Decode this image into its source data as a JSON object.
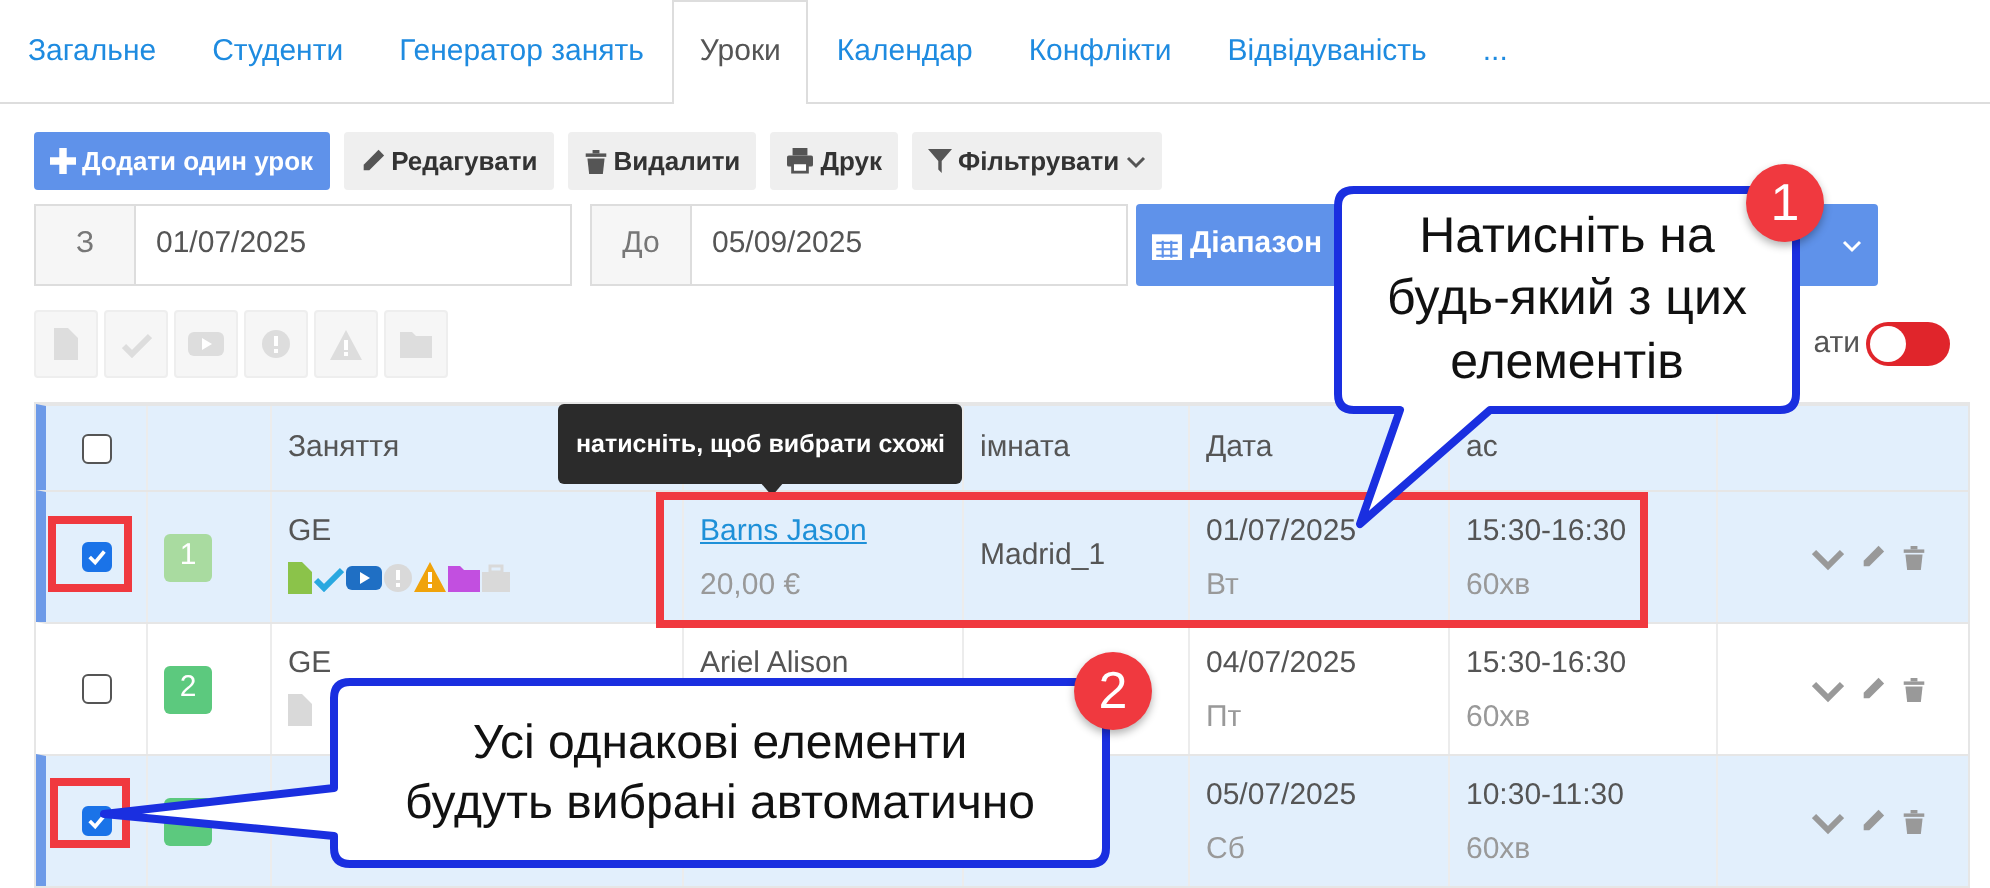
{
  "tabs": [
    {
      "label": "Загальне",
      "selected": false
    },
    {
      "label": "Студенти",
      "selected": false
    },
    {
      "label": "Генератор занять",
      "selected": false
    },
    {
      "label": "Уроки",
      "selected": true
    },
    {
      "label": "Календар",
      "selected": false
    },
    {
      "label": "Конфлікти",
      "selected": false
    },
    {
      "label": "Відвідуваність",
      "selected": false
    },
    {
      "label": "...",
      "selected": false
    }
  ],
  "toolbar": [
    {
      "kind": "add",
      "label": "Додати один урок",
      "primary": true
    },
    {
      "kind": "edit",
      "label": "Редагувати",
      "primary": false
    },
    {
      "kind": "delete",
      "label": "Видалити",
      "primary": false
    },
    {
      "kind": "print",
      "label": "Друк",
      "primary": false
    },
    {
      "kind": "filter",
      "label": "Фільтрувати",
      "primary": false
    }
  ],
  "date_range": {
    "from_label": "З",
    "from_value": "01/07/2025",
    "to_label": "До",
    "to_value": "05/09/2025",
    "range_button": "Діапазон"
  },
  "bulk_buttons": [
    {
      "kind": "document",
      "disabled": true
    },
    {
      "kind": "check",
      "disabled": true
    },
    {
      "kind": "video",
      "disabled": true
    },
    {
      "kind": "info",
      "disabled": true
    },
    {
      "kind": "warning",
      "disabled": true
    },
    {
      "kind": "folder",
      "disabled": true
    }
  ],
  "toggle": {
    "label": "ати",
    "on": false
  },
  "table": {
    "header": {
      "checked": false,
      "lesson": "Заняття",
      "room": "імната",
      "date": "Дата",
      "time": "ас"
    },
    "rows": [
      {
        "checked": true,
        "number": "1",
        "faded": true,
        "lesson": "GE",
        "status_icons": [
          {
            "kind": "document",
            "active": true
          },
          {
            "kind": "check",
            "active": true
          },
          {
            "kind": "video",
            "active": true
          },
          {
            "kind": "info",
            "active": false
          },
          {
            "kind": "warning",
            "active": true
          },
          {
            "kind": "folder",
            "active": true
          },
          {
            "kind": "briefcase",
            "active": false
          }
        ],
        "teacher": "Barns Jason",
        "link": true,
        "price": "20,00 €",
        "room": "Madrid_1",
        "date": "01/07/2025",
        "weekday": "Вт",
        "time": "15:30-16:30",
        "duration": "60хв"
      },
      {
        "checked": false,
        "number": "2",
        "faded": false,
        "lesson": "GE",
        "status_icons": [
          {
            "kind": "document",
            "active": false
          }
        ],
        "teacher": "Ariel Alison",
        "link": false,
        "date": "04/07/2025",
        "weekday": "Пт",
        "time": "15:30-16:30",
        "duration": "60хв"
      },
      {
        "checked": true,
        "faded": false,
        "date": "05/07/2025",
        "weekday": "Сб",
        "time": "10:30-11:30",
        "duration": "60хв"
      }
    ]
  },
  "tooltip": {
    "text": "натисніть, щоб вибрати схожі"
  },
  "callouts": [
    {
      "number": "1",
      "text": "Натисніть на будь-який з цих елементів"
    },
    {
      "number": "2",
      "text": "Усі однакові елементи будуть вибрані автоматично"
    }
  ]
}
